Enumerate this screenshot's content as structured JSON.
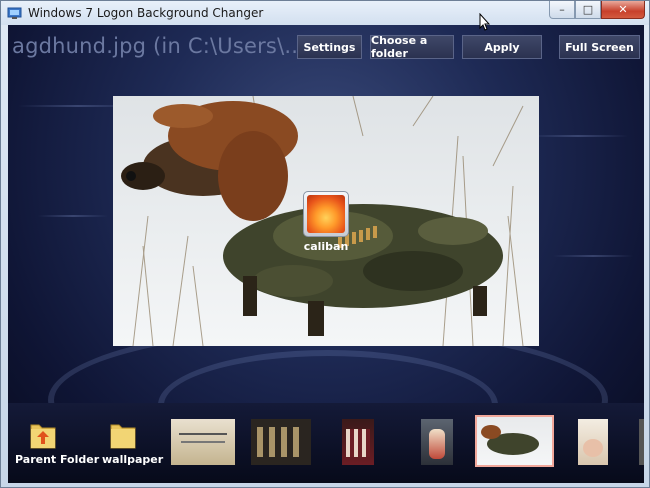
{
  "window": {
    "title": "Windows 7 Logon Background Changer",
    "buttons": {
      "minimize": "–",
      "maximize": "□",
      "close": "✕"
    }
  },
  "toolbar": {
    "path": "agdhund.jpg (in C:\\Users\\...",
    "settings_label": "Settings",
    "choose_folder_label": "Choose a folder",
    "apply_label": "Apply",
    "fullscreen_label": "Full Screen"
  },
  "preview": {
    "user_name": "caliban"
  },
  "strip": {
    "parent_folder_label": "Parent Folder",
    "wallpaper_label": "wallpaper"
  },
  "colors": {
    "accent_selected": "#f1a79a",
    "button_bg": "#2b3250",
    "background": "#0f1535"
  },
  "icons": [
    "app-icon",
    "folder-up-icon",
    "folder-icon",
    "cursor-icon"
  ]
}
